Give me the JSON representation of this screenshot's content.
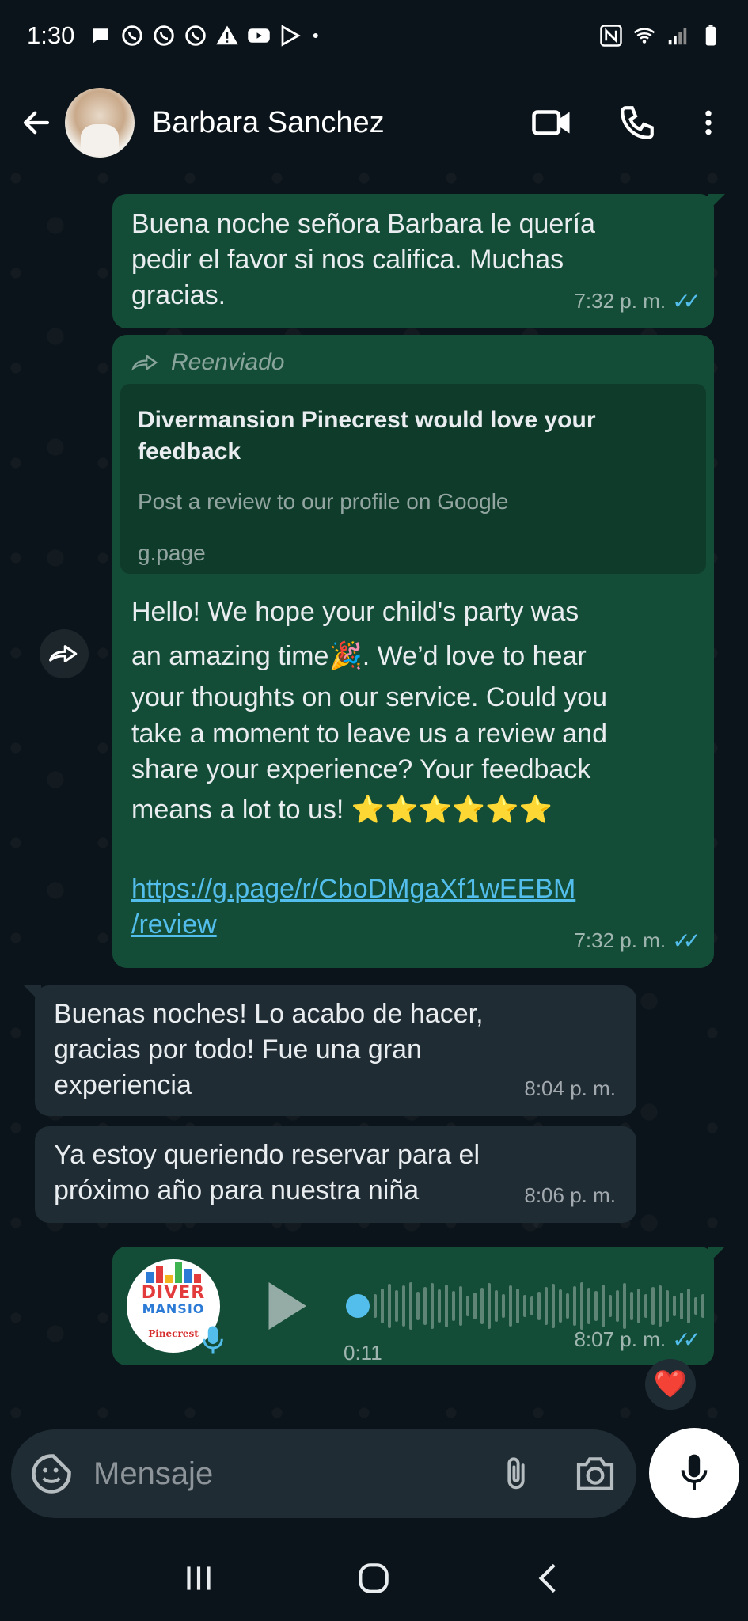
{
  "status_bar": {
    "time": "1:30",
    "icons": [
      "chat-bubble-icon",
      "whatsapp-icon",
      "whatsapp-icon",
      "whatsapp-icon",
      "alert-icon",
      "youtube-icon",
      "play-store-icon",
      "dot-icon",
      "nfc-icon",
      "wifi-icon",
      "signal-icon",
      "battery-icon"
    ]
  },
  "header": {
    "contact_name": "Barbara Sanchez",
    "icons": [
      "back-arrow-icon",
      "video-call-icon",
      "phone-icon",
      "more-vert-icon"
    ]
  },
  "messages": [
    {
      "direction": "out",
      "text_lines": [
        "Buena noche señora Barbara le quería",
        "pedir el favor si nos califica. Muchas",
        "gracias."
      ],
      "time": "7:32 p. m."
    },
    {
      "direction": "out",
      "forwarded_label": "Reenviado",
      "preview_title": "Divermansion Pinecrest would love your feedback",
      "preview_desc": "Post a review to our profile on Google",
      "preview_domain": "g.page",
      "text_lines": [
        "Hello! We hope your child's party was",
        "an amazing time🎉. We’d love to hear",
        "your thoughts on our service. Could you",
        "take a moment to leave us a review and",
        "share your experience? Your feedback",
        "means a lot to us! ⭐⭐⭐⭐⭐⭐"
      ],
      "link_lines": [
        "https://g.page/r/CboDMgaXf1wEEBM",
        "/review"
      ],
      "time": "7:32 p. m."
    },
    {
      "direction": "in",
      "text_lines": [
        "Buenas noches! Lo acabo de hacer,",
        "gracias por todo! Fue una gran",
        "experiencia"
      ],
      "time": "8:04 p. m."
    },
    {
      "direction": "in",
      "text_lines": [
        "Ya estoy queriendo reservar para el",
        "próximo año para nuestra niña"
      ],
      "time": "8:06 p. m."
    },
    {
      "direction": "out",
      "type": "voice",
      "avatar_text_top": "DIVER",
      "avatar_text_mid": "MANSIO",
      "avatar_text_bottom": "Pinecrest",
      "duration": "0:11",
      "time": "8:07 p. m.",
      "reaction": "❤️"
    }
  ],
  "input": {
    "placeholder": "Mensaje"
  },
  "colors": {
    "outgoing_bubble": "#144d37",
    "incoming_bubble": "#1f2c34",
    "read_ticks": "#53bdeb",
    "background": "#0b141a"
  }
}
